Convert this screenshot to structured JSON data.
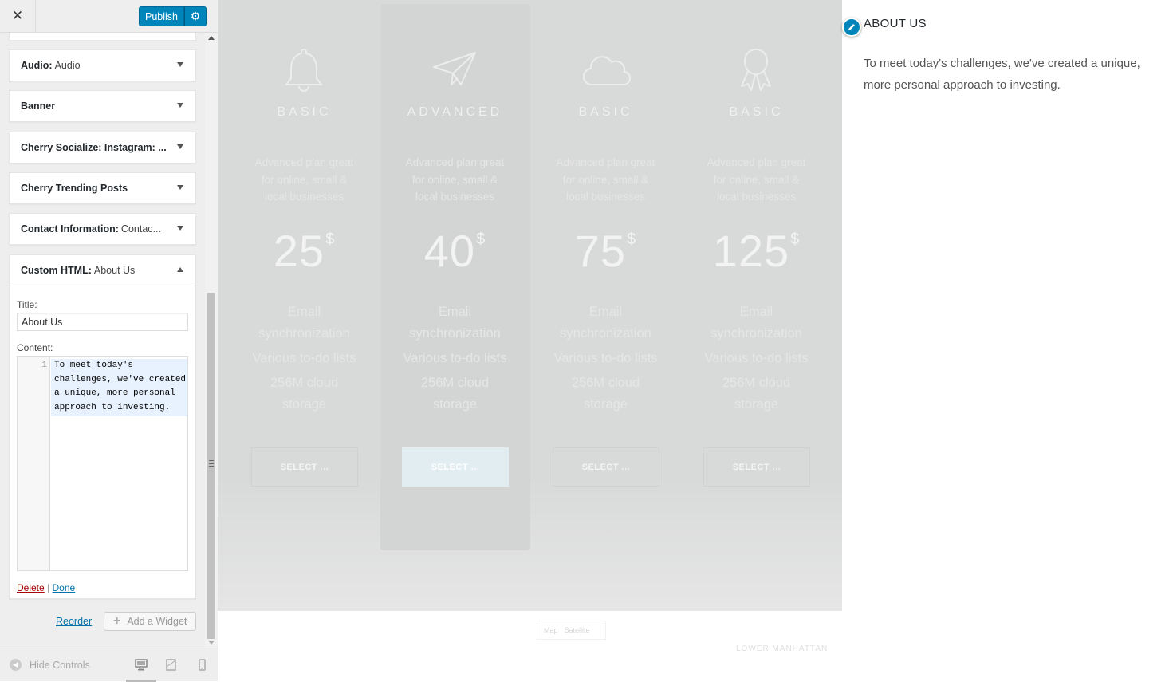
{
  "header": {
    "close_glyph": "✕",
    "publish_label": "Publish",
    "settings_glyph": "⚙"
  },
  "widgets": [
    {
      "type": "Audio:",
      "title": "Audio"
    },
    {
      "type": "Banner",
      "title": ""
    },
    {
      "type": "Cherry Socialize: Instagram: ...",
      "title": ""
    },
    {
      "type": "Cherry Trending Posts",
      "title": ""
    },
    {
      "type": "Contact Information:",
      "title": "Contac..."
    },
    {
      "type": "Custom HTML:",
      "title": "About Us"
    }
  ],
  "editor": {
    "title_label": "Title:",
    "title_value": "About Us",
    "content_label": "Content:",
    "line_number": "1",
    "content_value": "To meet today's challenges, we've created a unique, more personal approach to investing.",
    "delete_label": "Delete",
    "separator": "|",
    "done_label": "Done"
  },
  "footer_actions": {
    "reorder_label": "Reorder",
    "add_widget_label": "Add a Widget",
    "hide_controls_label": "Hide Controls"
  },
  "plans": [
    {
      "icon": "bell-icon",
      "name": "BASIC",
      "desc": "Advanced plan great for online, small & local businesses",
      "price": "25",
      "currency": "$",
      "features": [
        "Email synchronization",
        "Various to-do lists",
        "256M cloud storage"
      ],
      "button": "SELECT ..."
    },
    {
      "icon": "paper-plane-icon",
      "name": "ADVANCED",
      "desc": "Advanced plan great for online, small & local businesses",
      "price": "40",
      "currency": "$",
      "features": [
        "Email synchronization",
        "Various to-do lists",
        "256M cloud storage"
      ],
      "button": "SELECT ..."
    },
    {
      "icon": "cloud-icon",
      "name": "BASIC",
      "desc": "Advanced plan great for online, small & local businesses",
      "price": "75",
      "currency": "$",
      "features": [
        "Email synchronization",
        "Various to-do lists",
        "256M cloud storage"
      ],
      "button": "SELECT ..."
    },
    {
      "icon": "award-icon",
      "name": "BASIC",
      "desc": "Advanced plan great for online, small & local businesses",
      "price": "125",
      "currency": "$",
      "features": [
        "Email synchronization",
        "Various to-do lists",
        "256M cloud storage"
      ],
      "button": "SELECT ..."
    }
  ],
  "map": {
    "tab_map": "Map",
    "tab_satellite": "Satellite",
    "label_district": "LOWER MANHATTAN"
  },
  "about": {
    "title": "ABOUT US",
    "text": "To meet today's challenges, we've created a unique, more personal approach to investing."
  },
  "colors": {
    "primary": "#0085ba",
    "overlay": "#d8d9d9"
  }
}
